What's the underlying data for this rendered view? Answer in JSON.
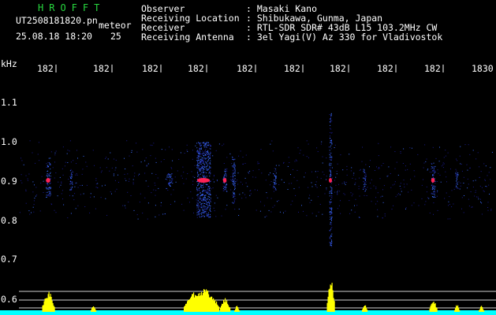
{
  "header": {
    "brand": "HROFFT",
    "filename": "UT2508181820.pn",
    "mode_label": "meteor",
    "datetime": "25.08.18 18:20",
    "count": "25"
  },
  "info": {
    "labels": [
      "Observer",
      "Receiving Location",
      "Receiver",
      "Receiving Antenna"
    ],
    "values": [
      ": Masaki Kano",
      ": Shibukawa, Gunma, Japan",
      ": RTL-SDR SDR# 43dB L15 103.2MHz CW",
      ": 3el Yagi(V) Az 330 for Vladivostok"
    ]
  },
  "spectrogram": {
    "unit_label": "kHz",
    "x_ticks": [
      "182",
      "182",
      "182",
      "182",
      "182",
      "182",
      "182",
      "182",
      "182",
      "1830"
    ],
    "y_ticks": [
      "1.1",
      "1.0",
      "0.9",
      "0.8",
      "0.7",
      "0.6"
    ],
    "colors": {
      "background": "#000000",
      "label": "#ffffff",
      "brand": "#27d83f",
      "signal_core": "#ff2255",
      "signal_mid": "#3a6cff",
      "signal_faint": "#1a1a8c",
      "activity_fill": "#ffff00",
      "activity_base": "#00ffff",
      "ref_line": "#d0d0d0"
    }
  }
}
